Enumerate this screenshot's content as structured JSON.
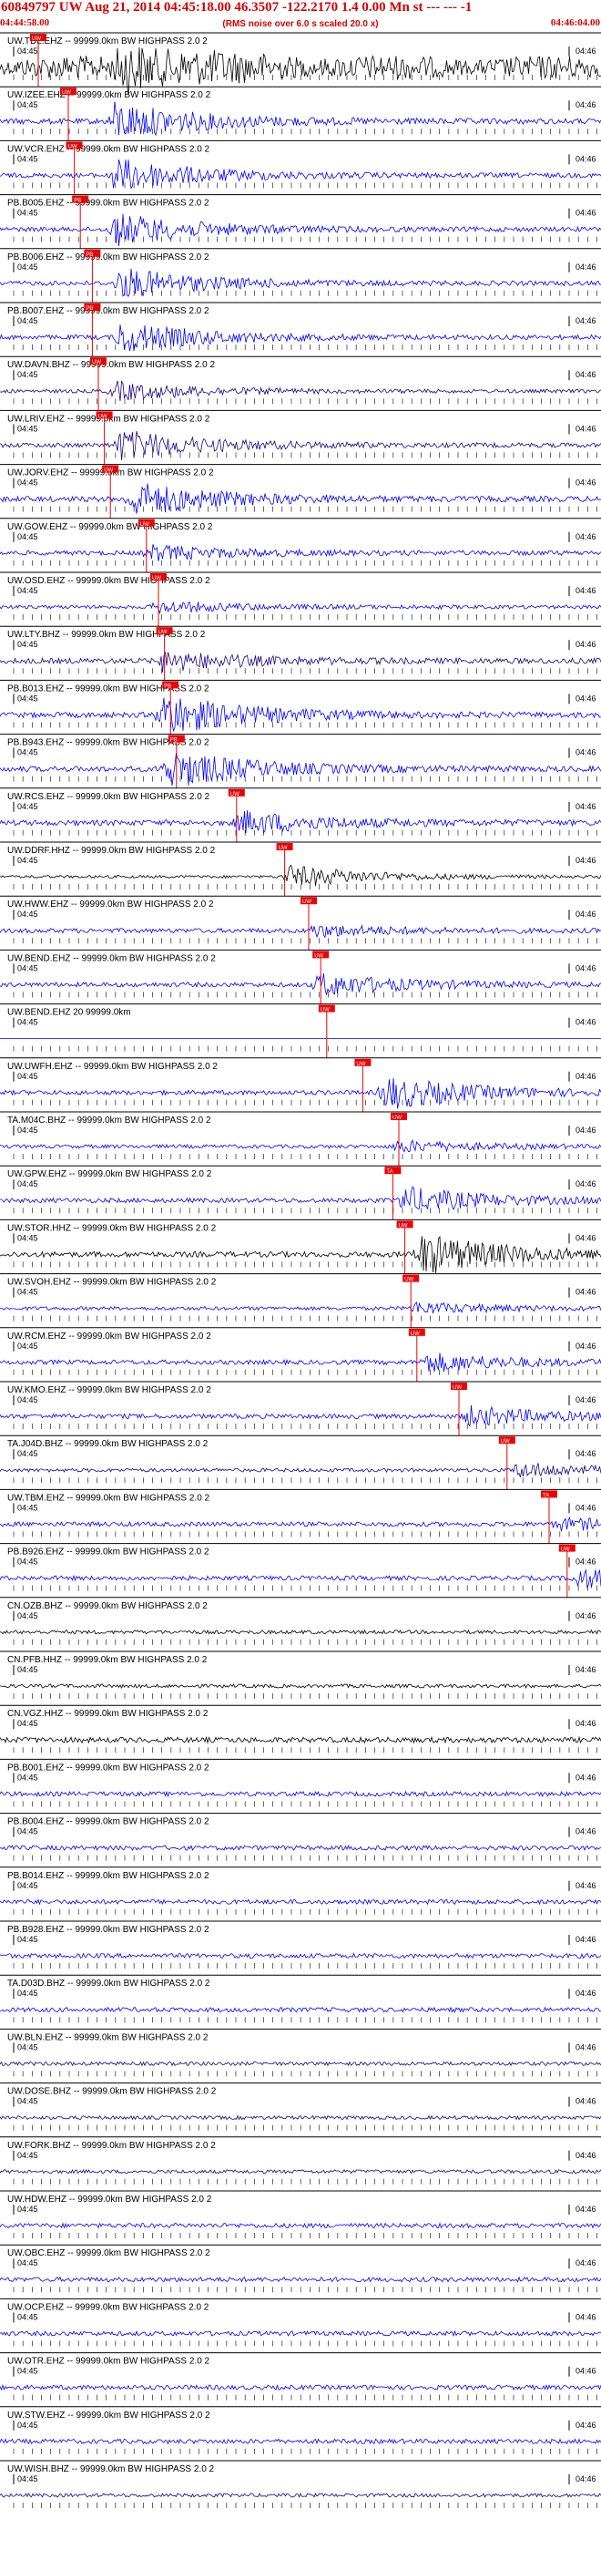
{
  "header": {
    "title": "60849797 UW Aug 21, 2014 04:45:18.00   46.3507 -122.2170  1.4 0.00 Mn st --- --- -1",
    "start_time": "04:44:58.00",
    "end_time": "04:46:04.00",
    "scale_note": "(RMS noise over 6.0 s scaled 20.0 x)"
  },
  "colors": {
    "header": "#d40000",
    "pick": "#ee0000",
    "blue": "#0000ff",
    "navy": "#1a0088",
    "black": "#000000"
  },
  "chart_data": {
    "type": "line",
    "title": "60849797 UW Aug 21, 2014 04:45:18.00",
    "time_ticks": [
      "04:45",
      "04:46"
    ],
    "time_window": [
      "04:44:58.00",
      "04:46:04.00"
    ],
    "traces": [
      {
        "label": "UW.TDL.EHZ -- 99999.0km BW  HIGHPASS  2.0  2",
        "color": "#000000",
        "noise": 7,
        "burst_at": 0.2,
        "burst_amp": 22,
        "pick": "UW",
        "pick_pos": 0.05,
        "extra": "noise"
      },
      {
        "label": "UW.IZEE.EHZ -- 99999.0km BW  HIGHPASS  2.0  2",
        "color": "#0000ff",
        "noise": 3,
        "burst_at": 0.19,
        "burst_amp": 20,
        "pick": "UW",
        "pick_pos": 0.1
      },
      {
        "label": "UW.VCR.EHZ -- 99999.0km BW  HIGHPASS  2.0  2",
        "color": "#0000ff",
        "noise": 2.5,
        "burst_at": 0.19,
        "burst_amp": 18,
        "pick": "UW",
        "pick_pos": 0.11
      },
      {
        "label": "PB.B005.EHZ -- 99999.0km BW  HIGHPASS  2.0  2",
        "color": "#0000ff",
        "noise": 2.5,
        "burst_at": 0.19,
        "burst_amp": 17,
        "pick": "PB",
        "pick_pos": 0.12
      },
      {
        "label": "PB.B006.EHZ -- 99999.0km BW  HIGHPASS  2.0  2",
        "color": "#0000ff",
        "noise": 2.5,
        "burst_at": 0.2,
        "burst_amp": 16,
        "pick": "PB",
        "pick_pos": 0.14
      },
      {
        "label": "PB.B007.EHZ -- 99999.0km BW  HIGHPASS  2.0  2",
        "color": "#0000ff",
        "noise": 2.5,
        "burst_at": 0.2,
        "burst_amp": 16,
        "pick": "PB",
        "pick_pos": 0.14
      },
      {
        "label": "UW.DAVN.BHZ -- 99999.0km BW  HIGHPASS  2.0  2",
        "color": "#1a0088",
        "noise": 2,
        "burst_at": 0.19,
        "burst_amp": 10,
        "pick": "UW",
        "pick_pos": 0.15
      },
      {
        "label": "UW.LRIV.EHZ -- 99999.0km BW  HIGHPASS  2.0  2",
        "color": "#1a0088",
        "noise": 2.5,
        "burst_at": 0.2,
        "burst_amp": 16,
        "pick": "UW",
        "pick_pos": 0.16
      },
      {
        "label": "UW.JORV.EHZ -- 99999.0km BW  HIGHPASS  2.0  2",
        "color": "#0000ff",
        "noise": 3,
        "burst_at": 0.22,
        "burst_amp": 18,
        "pick": "UW",
        "pick_pos": 0.17
      },
      {
        "label": "UW.GOW.EHZ -- 99999.0km BW  HIGHPASS  2.0  2",
        "color": "#0000ff",
        "noise": 2.5,
        "burst_at": 0.25,
        "burst_amp": 8,
        "pick": "UW",
        "pick_pos": 0.23
      },
      {
        "label": "UW.OSD.EHZ -- 99999.0km BW  HIGHPASS  2.0  2",
        "color": "#0000ff",
        "noise": 2,
        "burst_at": 0.26,
        "burst_amp": 6,
        "pick": "UW",
        "pick_pos": 0.25
      },
      {
        "label": "UW.LTY.BHZ -- 99999.0km BW  HIGHPASS  2.0  2",
        "color": "#1a0088",
        "noise": 3,
        "burst_at": 0.27,
        "burst_amp": 10,
        "pick": "UW",
        "pick_pos": 0.26
      },
      {
        "label": "PB.B013.EHZ -- 99999.0km BW  HIGHPASS  2.0  2",
        "color": "#0000ff",
        "noise": 3,
        "burst_at": 0.27,
        "burst_amp": 22,
        "pick": "PB",
        "pick_pos": 0.27
      },
      {
        "label": "PB.B943.EHZ -- 99999.0km BW  HIGHPASS  2.0  2",
        "color": "#0000ff",
        "noise": 3,
        "burst_at": 0.28,
        "burst_amp": 20,
        "pick": "PB",
        "pick_pos": 0.28
      },
      {
        "label": "UW.RCS.EHZ -- 99999.0km BW  HIGHPASS  2.0  2",
        "color": "#0000ff",
        "noise": 3,
        "burst_at": 0.4,
        "burst_amp": 12,
        "pick": "UW",
        "pick_pos": 0.38
      },
      {
        "label": "UW.DDRF.HHZ -- 99999.0km BW  HIGHPASS  2.0  2",
        "color": "#000000",
        "noise": 1.5,
        "burst_at": 0.48,
        "burst_amp": 12,
        "pick": "UW",
        "pick_pos": 0.46
      },
      {
        "label": "UW.HWW.EHZ -- 99999.0km BW  HIGHPASS  2.0  2",
        "color": "#0000ff",
        "noise": 2.5,
        "burst_at": 0.52,
        "burst_amp": 6,
        "pick": "UW",
        "pick_pos": 0.5
      },
      {
        "label": "UW.BEND.EHZ -- 99999.0km BW  HIGHPASS  2.0  2",
        "color": "#0000ff",
        "noise": 2.5,
        "burst_at": 0.53,
        "burst_amp": 12,
        "pick": "UW",
        "pick_pos": 0.52
      },
      {
        "label": "UW.BEND.EHZ 20 99999.0km",
        "color": "#0000ff",
        "noise": 0,
        "burst_at": 0,
        "burst_amp": 0,
        "pick": "UW",
        "pick_pos": 0.53,
        "flat": true
      },
      {
        "label": "UW.UWFH.EHZ -- 99999.0km BW  HIGHPASS  2.0  2",
        "color": "#0000ff",
        "noise": 2.5,
        "burst_at": 0.64,
        "burst_amp": 18,
        "pick": "UW",
        "pick_pos": 0.59
      },
      {
        "label": "TA.M04C.BHZ -- 99999.0km BW  HIGHPASS  2.0  2",
        "color": "#0000ff",
        "noise": 2,
        "burst_at": 0.66,
        "burst_amp": 6,
        "pick": "UW",
        "pick_pos": 0.65
      },
      {
        "label": "UW.GPW.EHZ -- 99999.0km BW  HIGHPASS  2.0  2",
        "color": "#0000ff",
        "noise": 2.5,
        "burst_at": 0.67,
        "burst_amp": 14,
        "pick": "TA",
        "pick_pos": 0.64
      },
      {
        "label": "UW.STOR.HHZ -- 99999.0km BW  HIGHPASS  2.0  2",
        "color": "#000000",
        "noise": 3,
        "burst_at": 0.7,
        "burst_amp": 22,
        "pick": "UW",
        "pick_pos": 0.66
      },
      {
        "label": "UW.SVOH.EHZ -- 99999.0km BW  HIGHPASS  2.0  2",
        "color": "#0000ff",
        "noise": 2,
        "burst_at": 0.69,
        "burst_amp": 6,
        "pick": "UW",
        "pick_pos": 0.67
      },
      {
        "label": "UW.RCM.EHZ -- 99999.0km BW  HIGHPASS  2.0  2",
        "color": "#0000ff",
        "noise": 2.5,
        "burst_at": 0.71,
        "burst_amp": 10,
        "pick": "UW",
        "pick_pos": 0.68
      },
      {
        "label": "UW.KMO.EHZ -- 99999.0km BW  HIGHPASS  2.0  2",
        "color": "#0000ff",
        "noise": 2.5,
        "burst_at": 0.78,
        "burst_amp": 10,
        "pick": "UW",
        "pick_pos": 0.75
      },
      {
        "label": "TA.J04D.BHZ -- 99999.0km BW  HIGHPASS  2.0  2",
        "color": "#1a0088",
        "noise": 2,
        "burst_at": 0.86,
        "burst_amp": 8,
        "pick": "UW",
        "pick_pos": 0.83
      },
      {
        "label": "UW.TBM.EHZ -- 99999.0km BW  HIGHPASS  2.0  2",
        "color": "#0000ff",
        "noise": 2.5,
        "burst_at": 0.93,
        "burst_amp": 6,
        "pick": "TA",
        "pick_pos": 0.9
      },
      {
        "label": "PB.B926.EHZ -- 99999.0km BW  HIGHPASS  2.0  2",
        "color": "#0000ff",
        "noise": 2.5,
        "burst_at": 0.96,
        "burst_amp": 10,
        "pick": "UW",
        "pick_pos": 0.93
      },
      {
        "label": "CN.OZB.BHZ -- 99999.0km BW  HIGHPASS  2.0  2",
        "color": "#000000",
        "noise": 2,
        "burst_at": 0,
        "burst_amp": 0,
        "pick": "",
        "pick_pos": 0
      },
      {
        "label": "CN.PFB.HHZ -- 99999.0km BW  HIGHPASS  2.0  2",
        "color": "#000000",
        "noise": 2,
        "burst_at": 0,
        "burst_amp": 0,
        "pick": "",
        "pick_pos": 0
      },
      {
        "label": "CN.VGZ.HHZ -- 99999.0km BW  HIGHPASS  2.0  2",
        "color": "#000000",
        "noise": 3,
        "burst_at": 0,
        "burst_amp": 0,
        "pick": "",
        "pick_pos": 0
      },
      {
        "label": "PB.B001.EHZ -- 99999.0km BW  HIGHPASS  2.0  2",
        "color": "#0000ff",
        "noise": 2.5,
        "burst_at": 0,
        "burst_amp": 0,
        "pick": "",
        "pick_pos": 0
      },
      {
        "label": "PB.B004.EHZ -- 99999.0km BW  HIGHPASS  2.0  2",
        "color": "#0000ff",
        "noise": 2.5,
        "burst_at": 0,
        "burst_amp": 0,
        "pick": "",
        "pick_pos": 0
      },
      {
        "label": "PB.B014.EHZ -- 99999.0km BW  HIGHPASS  2.0  2",
        "color": "#0000ff",
        "noise": 2.5,
        "burst_at": 0,
        "burst_amp": 0,
        "pick": "",
        "pick_pos": 0
      },
      {
        "label": "PB.B928.EHZ -- 99999.0km BW  HIGHPASS  2.0  2",
        "color": "#0000ff",
        "noise": 2.5,
        "burst_at": 0,
        "burst_amp": 0,
        "pick": "",
        "pick_pos": 0
      },
      {
        "label": "TA.D03D.BHZ -- 99999.0km BW  HIGHPASS  2.0  2",
        "color": "#0000ff",
        "noise": 2.5,
        "burst_at": 0,
        "burst_amp": 0,
        "pick": "",
        "pick_pos": 0
      },
      {
        "label": "UW.BLN.EHZ -- 99999.0km BW  HIGHPASS  2.0  2",
        "color": "#1a0088",
        "noise": 2,
        "burst_at": 0,
        "burst_amp": 0,
        "pick": "",
        "pick_pos": 0
      },
      {
        "label": "UW.DOSE.BHZ -- 99999.0km BW  HIGHPASS  2.0  2",
        "color": "#1a0088",
        "noise": 2,
        "burst_at": 0,
        "burst_amp": 0,
        "pick": "",
        "pick_pos": 0
      },
      {
        "label": "UW.FORK.BHZ -- 99999.0km BW  HIGHPASS  2.0  2",
        "color": "#1a0088",
        "noise": 2,
        "burst_at": 0,
        "burst_amp": 0,
        "pick": "",
        "pick_pos": 0
      },
      {
        "label": "UW.HDW.EHZ -- 99999.0km BW  HIGHPASS  2.0  2",
        "color": "#0000ff",
        "noise": 2.5,
        "burst_at": 0,
        "burst_amp": 0,
        "pick": "",
        "pick_pos": 0
      },
      {
        "label": "UW.OBC.EHZ -- 99999.0km BW  HIGHPASS  2.0  2",
        "color": "#0000ff",
        "noise": 2.5,
        "burst_at": 0,
        "burst_amp": 0,
        "pick": "",
        "pick_pos": 0
      },
      {
        "label": "UW.OCP.EHZ -- 99999.0km BW  HIGHPASS  2.0  2",
        "color": "#0000ff",
        "noise": 2.5,
        "burst_at": 0,
        "burst_amp": 0,
        "pick": "",
        "pick_pos": 0
      },
      {
        "label": "UW.OTR.EHZ -- 99999.0km BW  HIGHPASS  2.0  2",
        "color": "#0000ff",
        "noise": 2.5,
        "burst_at": 0,
        "burst_amp": 0,
        "pick": "",
        "pick_pos": 0
      },
      {
        "label": "UW.STW.EHZ -- 99999.0km BW  HIGHPASS  2.0  2",
        "color": "#0000ff",
        "noise": 2.5,
        "burst_at": 0,
        "burst_amp": 0,
        "pick": "",
        "pick_pos": 0
      },
      {
        "label": "UW.WISH.BHZ -- 99999.0km BW  HIGHPASS  2.0  2",
        "color": "#1a0088",
        "noise": 2,
        "burst_at": 0,
        "burst_amp": 0,
        "pick": "",
        "pick_pos": 0
      }
    ]
  }
}
